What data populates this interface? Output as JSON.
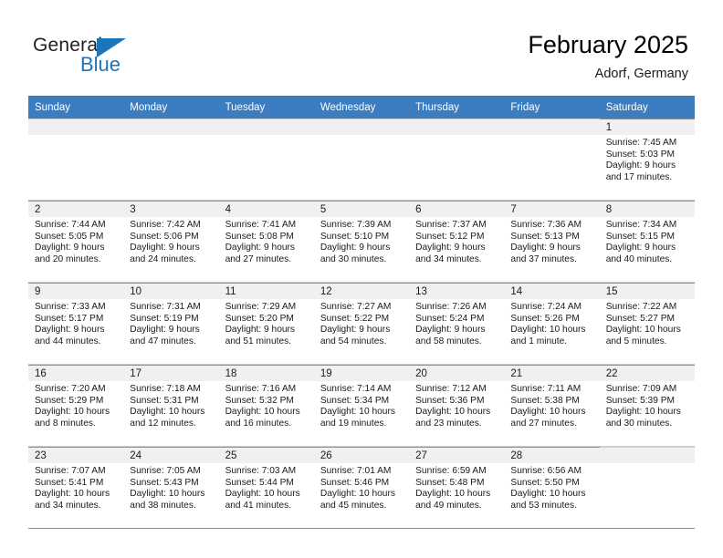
{
  "brand": {
    "name_part1": "General",
    "name_part2": "Blue",
    "triangle_color": "#1b75bb",
    "text_color": "#231f20"
  },
  "header": {
    "title": "February 2025",
    "subtitle": "Adorf, Germany"
  },
  "colors": {
    "header_row_bg": "#3b7dc0",
    "header_row_text": "#ffffff",
    "daynum_bg": "#f0f0f0",
    "grid_line": "#8e8e8e",
    "text": "#1a1a1a"
  },
  "weekday_headers": [
    "Sunday",
    "Monday",
    "Tuesday",
    "Wednesday",
    "Thursday",
    "Friday",
    "Saturday"
  ],
  "weeks": [
    [
      {
        "empty": true
      },
      {
        "empty": true
      },
      {
        "empty": true
      },
      {
        "empty": true
      },
      {
        "empty": true
      },
      {
        "empty": true
      },
      {
        "empty": false,
        "day": "1",
        "sunrise": "Sunrise: 7:45 AM",
        "sunset": "Sunset: 5:03 PM",
        "daylight_line1": "Daylight: 9 hours",
        "daylight_line2": "and 17 minutes."
      }
    ],
    [
      {
        "empty": false,
        "day": "2",
        "sunrise": "Sunrise: 7:44 AM",
        "sunset": "Sunset: 5:05 PM",
        "daylight_line1": "Daylight: 9 hours",
        "daylight_line2": "and 20 minutes."
      },
      {
        "empty": false,
        "day": "3",
        "sunrise": "Sunrise: 7:42 AM",
        "sunset": "Sunset: 5:06 PM",
        "daylight_line1": "Daylight: 9 hours",
        "daylight_line2": "and 24 minutes."
      },
      {
        "empty": false,
        "day": "4",
        "sunrise": "Sunrise: 7:41 AM",
        "sunset": "Sunset: 5:08 PM",
        "daylight_line1": "Daylight: 9 hours",
        "daylight_line2": "and 27 minutes."
      },
      {
        "empty": false,
        "day": "5",
        "sunrise": "Sunrise: 7:39 AM",
        "sunset": "Sunset: 5:10 PM",
        "daylight_line1": "Daylight: 9 hours",
        "daylight_line2": "and 30 minutes."
      },
      {
        "empty": false,
        "day": "6",
        "sunrise": "Sunrise: 7:37 AM",
        "sunset": "Sunset: 5:12 PM",
        "daylight_line1": "Daylight: 9 hours",
        "daylight_line2": "and 34 minutes."
      },
      {
        "empty": false,
        "day": "7",
        "sunrise": "Sunrise: 7:36 AM",
        "sunset": "Sunset: 5:13 PM",
        "daylight_line1": "Daylight: 9 hours",
        "daylight_line2": "and 37 minutes."
      },
      {
        "empty": false,
        "day": "8",
        "sunrise": "Sunrise: 7:34 AM",
        "sunset": "Sunset: 5:15 PM",
        "daylight_line1": "Daylight: 9 hours",
        "daylight_line2": "and 40 minutes."
      }
    ],
    [
      {
        "empty": false,
        "day": "9",
        "sunrise": "Sunrise: 7:33 AM",
        "sunset": "Sunset: 5:17 PM",
        "daylight_line1": "Daylight: 9 hours",
        "daylight_line2": "and 44 minutes."
      },
      {
        "empty": false,
        "day": "10",
        "sunrise": "Sunrise: 7:31 AM",
        "sunset": "Sunset: 5:19 PM",
        "daylight_line1": "Daylight: 9 hours",
        "daylight_line2": "and 47 minutes."
      },
      {
        "empty": false,
        "day": "11",
        "sunrise": "Sunrise: 7:29 AM",
        "sunset": "Sunset: 5:20 PM",
        "daylight_line1": "Daylight: 9 hours",
        "daylight_line2": "and 51 minutes."
      },
      {
        "empty": false,
        "day": "12",
        "sunrise": "Sunrise: 7:27 AM",
        "sunset": "Sunset: 5:22 PM",
        "daylight_line1": "Daylight: 9 hours",
        "daylight_line2": "and 54 minutes."
      },
      {
        "empty": false,
        "day": "13",
        "sunrise": "Sunrise: 7:26 AM",
        "sunset": "Sunset: 5:24 PM",
        "daylight_line1": "Daylight: 9 hours",
        "daylight_line2": "and 58 minutes."
      },
      {
        "empty": false,
        "day": "14",
        "sunrise": "Sunrise: 7:24 AM",
        "sunset": "Sunset: 5:26 PM",
        "daylight_line1": "Daylight: 10 hours",
        "daylight_line2": "and 1 minute."
      },
      {
        "empty": false,
        "day": "15",
        "sunrise": "Sunrise: 7:22 AM",
        "sunset": "Sunset: 5:27 PM",
        "daylight_line1": "Daylight: 10 hours",
        "daylight_line2": "and 5 minutes."
      }
    ],
    [
      {
        "empty": false,
        "day": "16",
        "sunrise": "Sunrise: 7:20 AM",
        "sunset": "Sunset: 5:29 PM",
        "daylight_line1": "Daylight: 10 hours",
        "daylight_line2": "and 8 minutes."
      },
      {
        "empty": false,
        "day": "17",
        "sunrise": "Sunrise: 7:18 AM",
        "sunset": "Sunset: 5:31 PM",
        "daylight_line1": "Daylight: 10 hours",
        "daylight_line2": "and 12 minutes."
      },
      {
        "empty": false,
        "day": "18",
        "sunrise": "Sunrise: 7:16 AM",
        "sunset": "Sunset: 5:32 PM",
        "daylight_line1": "Daylight: 10 hours",
        "daylight_line2": "and 16 minutes."
      },
      {
        "empty": false,
        "day": "19",
        "sunrise": "Sunrise: 7:14 AM",
        "sunset": "Sunset: 5:34 PM",
        "daylight_line1": "Daylight: 10 hours",
        "daylight_line2": "and 19 minutes."
      },
      {
        "empty": false,
        "day": "20",
        "sunrise": "Sunrise: 7:12 AM",
        "sunset": "Sunset: 5:36 PM",
        "daylight_line1": "Daylight: 10 hours",
        "daylight_line2": "and 23 minutes."
      },
      {
        "empty": false,
        "day": "21",
        "sunrise": "Sunrise: 7:11 AM",
        "sunset": "Sunset: 5:38 PM",
        "daylight_line1": "Daylight: 10 hours",
        "daylight_line2": "and 27 minutes."
      },
      {
        "empty": false,
        "day": "22",
        "sunrise": "Sunrise: 7:09 AM",
        "sunset": "Sunset: 5:39 PM",
        "daylight_line1": "Daylight: 10 hours",
        "daylight_line2": "and 30 minutes."
      }
    ],
    [
      {
        "empty": false,
        "day": "23",
        "sunrise": "Sunrise: 7:07 AM",
        "sunset": "Sunset: 5:41 PM",
        "daylight_line1": "Daylight: 10 hours",
        "daylight_line2": "and 34 minutes."
      },
      {
        "empty": false,
        "day": "24",
        "sunrise": "Sunrise: 7:05 AM",
        "sunset": "Sunset: 5:43 PM",
        "daylight_line1": "Daylight: 10 hours",
        "daylight_line2": "and 38 minutes."
      },
      {
        "empty": false,
        "day": "25",
        "sunrise": "Sunrise: 7:03 AM",
        "sunset": "Sunset: 5:44 PM",
        "daylight_line1": "Daylight: 10 hours",
        "daylight_line2": "and 41 minutes."
      },
      {
        "empty": false,
        "day": "26",
        "sunrise": "Sunrise: 7:01 AM",
        "sunset": "Sunset: 5:46 PM",
        "daylight_line1": "Daylight: 10 hours",
        "daylight_line2": "and 45 minutes."
      },
      {
        "empty": false,
        "day": "27",
        "sunrise": "Sunrise: 6:59 AM",
        "sunset": "Sunset: 5:48 PM",
        "daylight_line1": "Daylight: 10 hours",
        "daylight_line2": "and 49 minutes."
      },
      {
        "empty": false,
        "day": "28",
        "sunrise": "Sunrise: 6:56 AM",
        "sunset": "Sunset: 5:50 PM",
        "daylight_line1": "Daylight: 10 hours",
        "daylight_line2": "and 53 minutes."
      },
      {
        "empty": true
      }
    ]
  ]
}
